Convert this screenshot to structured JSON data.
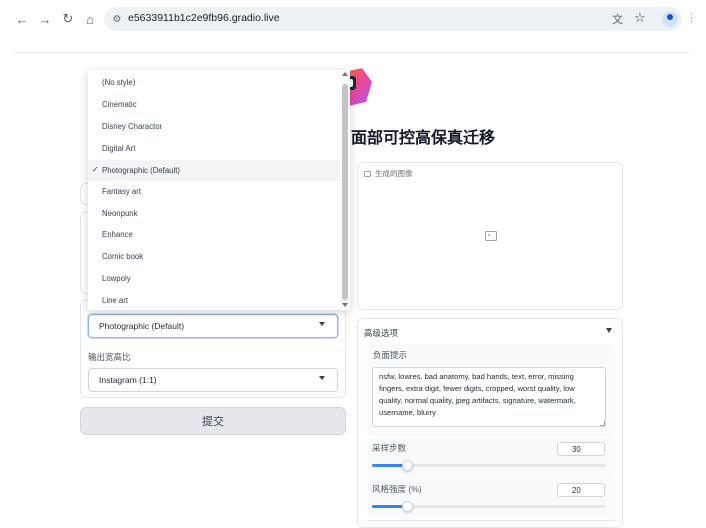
{
  "browser": {
    "url": "e5633911b1c2e9fb96.gradio.live",
    "icons": [
      "back-icon",
      "forward-icon",
      "reload-icon",
      "home-icon",
      "site-info-icon",
      "translate-icon",
      "bookmark-star-icon",
      "profile-icon",
      "menu-icon"
    ]
  },
  "app": {
    "title": "面部可控高保真迁移",
    "style_dropdown": {
      "selected": "Photographic (Default)",
      "options": [
        "(No style)",
        "Cinematic",
        "Disney Charactor",
        "Digital Art",
        "Photographic (Default)",
        "Fantasy art",
        "Neonpunk",
        "Enhance",
        "Comic book",
        "Lowpoly",
        "Line art"
      ],
      "check_mark": "✓"
    },
    "ratio_label": "输出宽高比",
    "ratio_value": "Instagram (1:1)",
    "submit_label": "提交",
    "output_label": "生成的图像",
    "advanced": {
      "title": "高级选项",
      "negative_label": "负面提示",
      "negative_prompt": "nsfw, lowres, bad anatomy, bad hands, text, error, missing fingers, extra digit, fewer digits, cropped, worst quality, low quality, normal quality, jpeg artifacts, signature, watermark, username, blurry",
      "steps_label": "采样步数",
      "steps_value": "30",
      "steps_fraction": 0.15,
      "strength_label": "风格强度 (%)",
      "strength_value": "20",
      "strength_fraction": 0.15
    }
  },
  "colors": {
    "accent": "#3b82f6",
    "logo_orange": "#f97316",
    "logo_pink": "#ec4899",
    "logo_purple": "#a855f7"
  }
}
